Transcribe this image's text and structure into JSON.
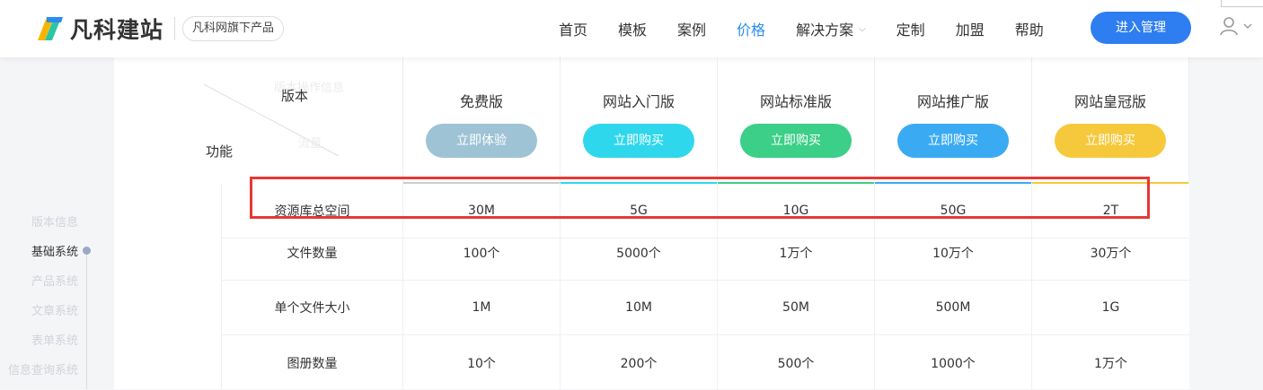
{
  "header": {
    "brand": "凡科建站",
    "slogan": "凡科网旗下产品",
    "nav": [
      {
        "label": "首页",
        "active": false
      },
      {
        "label": "模板",
        "active": false
      },
      {
        "label": "案例",
        "active": false
      },
      {
        "label": "价格",
        "active": true
      },
      {
        "label": "解决方案",
        "active": false,
        "dropdown": true
      },
      {
        "label": "定制",
        "active": false
      },
      {
        "label": "加盟",
        "active": false
      },
      {
        "label": "帮助",
        "active": false
      }
    ],
    "enter_label": "进入管理",
    "user_icon": "user-icon"
  },
  "sidebar": {
    "items": [
      "版本信息",
      "基础系统",
      "产品系统",
      "文章系统",
      "表单系统",
      "信息查询系统"
    ],
    "active_index": 1
  },
  "table": {
    "corner": {
      "version_label": "版本",
      "function_label": "功能",
      "ghost_top": "版本操作信息",
      "ghost_bottom": "流量"
    },
    "plans": [
      {
        "name": "免费版",
        "button": "立即体验",
        "color": "#9ec3d5",
        "line": "#cccccc"
      },
      {
        "name": "网站入门版",
        "button": "立即购买",
        "color": "#2fd7ec",
        "line": "#2fd7ec"
      },
      {
        "name": "网站标准版",
        "button": "立即购买",
        "color": "#3bcf87",
        "line": "#3bcf87"
      },
      {
        "name": "网站推广版",
        "button": "立即购买",
        "color": "#3aabf3",
        "line": "#3aabf3"
      },
      {
        "name": "网站皇冠版",
        "button": "立即购买",
        "color": "#f6c93c",
        "line": "#f6c93c"
      }
    ],
    "rows": [
      {
        "feature": "资源库总空间",
        "values": [
          "30M",
          "5G",
          "10G",
          "50G",
          "2T"
        ]
      },
      {
        "feature": "文件数量",
        "values": [
          "100个",
          "5000个",
          "1万个",
          "10万个",
          "30万个"
        ]
      },
      {
        "feature": "单个文件大小",
        "values": [
          "1M",
          "10M",
          "50M",
          "500M",
          "1G"
        ]
      },
      {
        "feature": "图册数量",
        "values": [
          "10个",
          "200个",
          "500个",
          "1000个",
          "1万个"
        ]
      }
    ],
    "highlight_color": "#e53935"
  }
}
